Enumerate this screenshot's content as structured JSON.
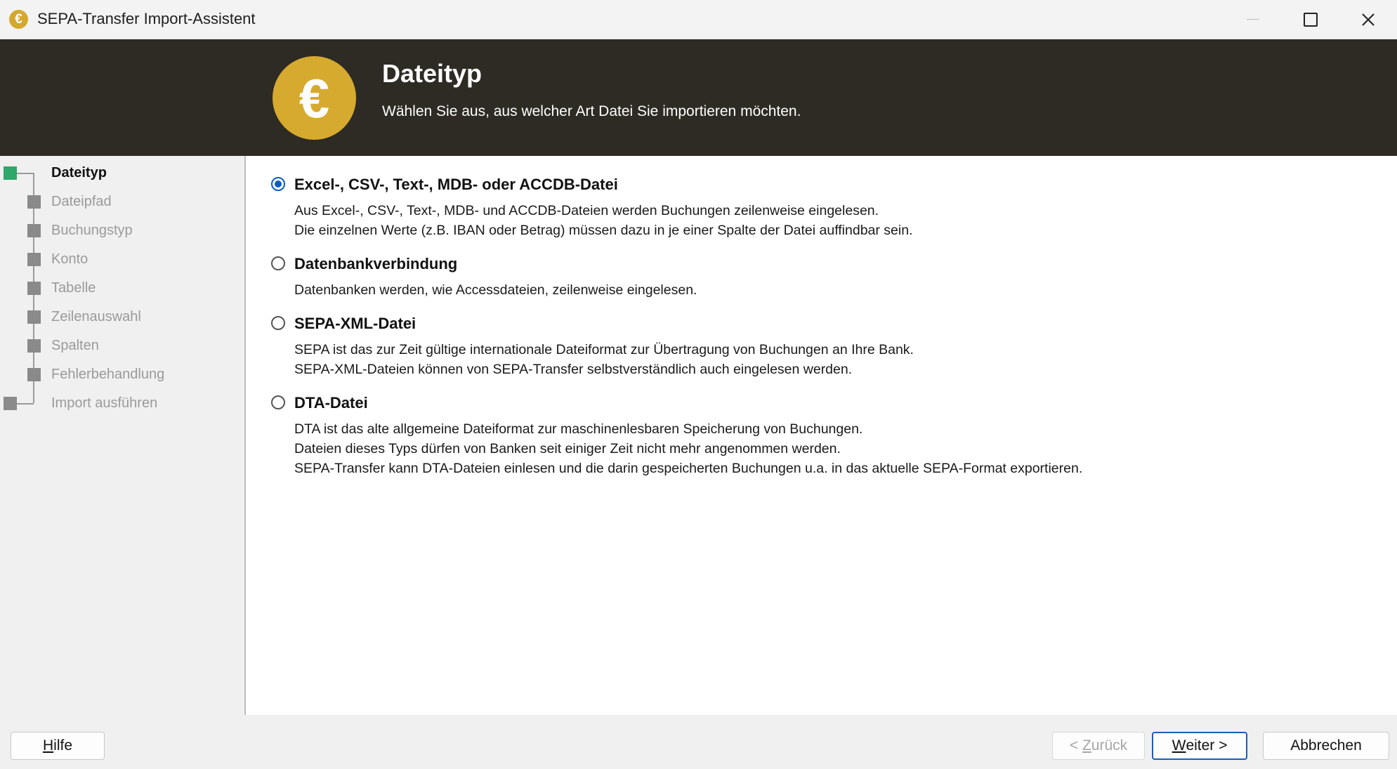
{
  "window": {
    "title": "SEPA-Transfer Import-Assistent",
    "icon": "euro-icon"
  },
  "header": {
    "title": "Dateityp",
    "subtitle": "Wählen Sie aus, aus welcher Art Datei Sie importieren möchten.",
    "logo_glyph": "€",
    "logo_color": "#d6aa2e",
    "background_color": "#2e2b24"
  },
  "steps": {
    "active_index": 0,
    "active_color": "#2ea86b",
    "items": [
      {
        "label": "Dateityp"
      },
      {
        "label": "Dateipfad"
      },
      {
        "label": "Buchungstyp"
      },
      {
        "label": "Konto"
      },
      {
        "label": "Tabelle"
      },
      {
        "label": "Zeilenauswahl"
      },
      {
        "label": "Spalten"
      },
      {
        "label": "Fehlerbehandlung"
      },
      {
        "label": "Import ausführen"
      }
    ]
  },
  "options": {
    "selected_index": 0,
    "items": [
      {
        "title": "Excel-, CSV-, Text-, MDB- oder ACCDB-Datei",
        "lines": [
          "Aus Excel-, CSV-, Text-, MDB- und ACCDB-Dateien werden Buchungen zeilenweise eingelesen.",
          "Die einzelnen Werte (z.B. IBAN oder Betrag) müssen dazu in je einer Spalte der Datei auffindbar sein."
        ]
      },
      {
        "title": "Datenbankverbindung",
        "lines": [
          "Datenbanken werden, wie Accessdateien, zeilenweise eingelesen."
        ]
      },
      {
        "title": "SEPA-XML-Datei",
        "lines": [
          "SEPA ist das zur Zeit gültige internationale Dateiformat zur Übertragung von Buchungen an Ihre Bank.",
          "SEPA-XML-Dateien können von SEPA-Transfer selbstverständlich auch eingelesen werden."
        ]
      },
      {
        "title": "DTA-Datei",
        "lines": [
          "DTA ist das alte allgemeine Dateiformat zur maschinenlesbaren Speicherung von Buchungen.",
          "Dateien dieses Typs dürfen von Banken seit einiger Zeit nicht mehr angenommen werden.",
          "SEPA-Transfer kann DTA-Dateien einlesen und die darin gespeicherten Buchungen u.a. in das aktuelle SEPA-Format exportieren."
        ]
      }
    ]
  },
  "footer": {
    "help": {
      "mnemonic": "H",
      "rest": "ilfe"
    },
    "back": {
      "prefix": "< ",
      "mnemonic": "Z",
      "rest": "urück",
      "enabled": false
    },
    "next": {
      "mnemonic": "W",
      "rest": "eiter >"
    },
    "cancel": "Abbrechen"
  }
}
